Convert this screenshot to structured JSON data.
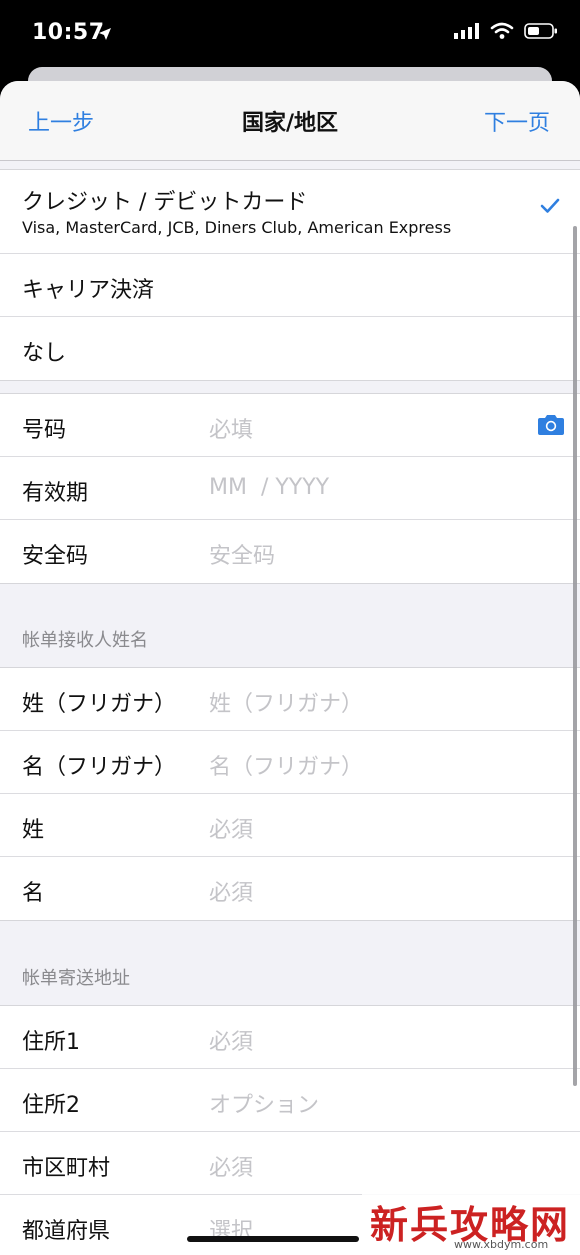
{
  "status_bar": {
    "time": "10:57"
  },
  "nav": {
    "back": "上一步",
    "title": "国家/地区",
    "next": "下一页"
  },
  "payment": {
    "card": {
      "label": "クレジット / デビットカード",
      "sub": "Visa, MasterCard, JCB, Diners Club, American Express"
    },
    "carrier": "キャリア決済",
    "none": "なし"
  },
  "card_fields": {
    "number": {
      "label": "号码",
      "placeholder": "必填"
    },
    "expiry": {
      "label": "有效期",
      "placeholder": "MM  / YYYY"
    },
    "cvv": {
      "label": "安全码",
      "placeholder": "安全码"
    }
  },
  "name_section": {
    "header": "帐单接收人姓名",
    "last_kana": {
      "label": "姓（フリガナ）",
      "placeholder": "姓（フリガナ）"
    },
    "first_kana": {
      "label": "名（フリガナ）",
      "placeholder": "名（フリガナ）"
    },
    "last": {
      "label": "姓",
      "placeholder": "必須"
    },
    "first": {
      "label": "名",
      "placeholder": "必須"
    }
  },
  "address_section": {
    "header": "帐单寄送地址",
    "addr1": {
      "label": "住所1",
      "placeholder": "必須"
    },
    "addr2": {
      "label": "住所2",
      "placeholder": "オプション"
    },
    "city": {
      "label": "市区町村",
      "placeholder": "必須"
    },
    "prefecture": {
      "label": "都道府県",
      "placeholder": "選択"
    }
  },
  "watermark": {
    "main": "新兵攻略网",
    "url": "www.xbdym.com"
  },
  "colors": {
    "accent": "#2f7fe0",
    "placeholder": "#c4c4c8",
    "section_bg": "#f2f2f7"
  }
}
